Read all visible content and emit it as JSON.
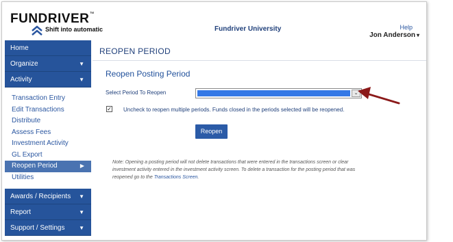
{
  "header": {
    "logo_text": "FUNDRIVER",
    "logo_tm": "™",
    "tagline": "Shift into automatic",
    "org_name": "Fundriver University",
    "help_label": "Help",
    "user_name": "Jon Anderson",
    "user_caret": "▾"
  },
  "sidebar": {
    "home": "Home",
    "organize": "Organize",
    "activity": "Activity",
    "activity_items": [
      "Transaction Entry",
      "Edit Transactions",
      "Distribute",
      "Assess Fees",
      "Investment Activity",
      "GL Export",
      "Reopen Period",
      "Utilities"
    ],
    "awards": "Awards / Recipients",
    "report": "Report",
    "support": "Support / Settings",
    "caret_down": "▼",
    "caret_right": "▶"
  },
  "main": {
    "page_title": "REOPEN PERIOD",
    "section_title": "Reopen Posting Period",
    "period_label": "Select Period To Reopen",
    "period_value": "",
    "select_arrow": "⌄",
    "multi_checked": "✓",
    "multi_label": "Uncheck to reopen multiple periods. Funds closed in the periods selected will be reopened.",
    "reopen_button": "Reopen",
    "note_text": "Note: Opening a posting period will not delete transactions that were entered in the transactions screen or clear investment activity entered in the investment activity screen. To delete a transaction for the posting period that was reopened go to the",
    "note_link": "Transactions Screen",
    "note_end": "."
  },
  "colors": {
    "nav_blue": "#26549b",
    "active_blue": "#4a73b1",
    "select_fill": "#3478e6",
    "annotation": "#8b1a1a"
  }
}
